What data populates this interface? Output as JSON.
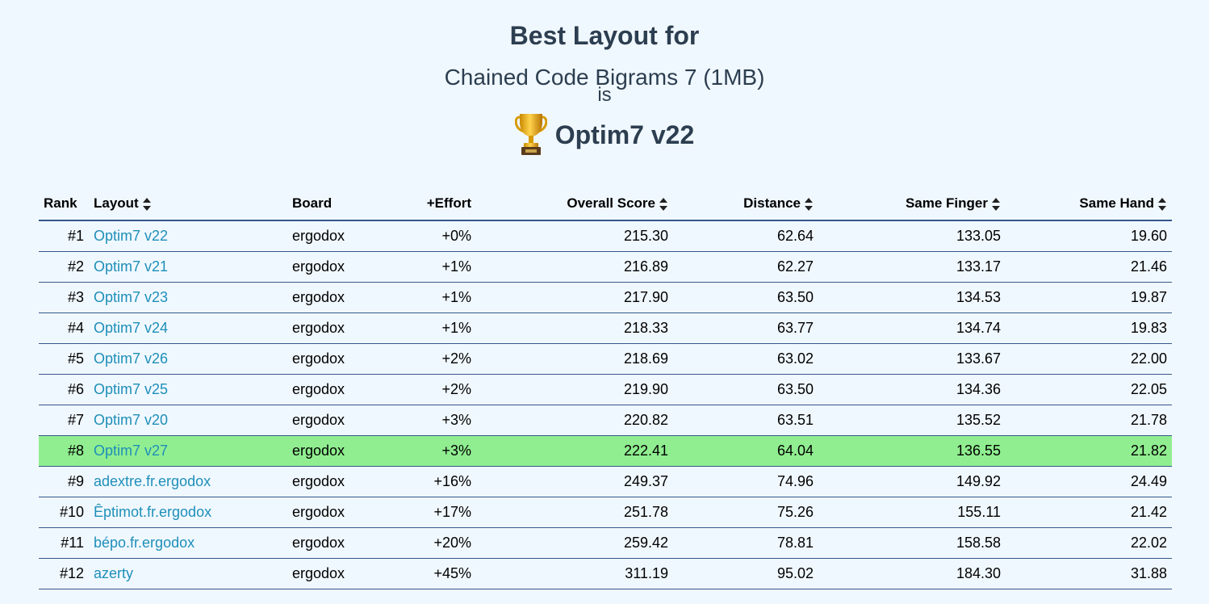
{
  "header": {
    "title": "Best Layout for",
    "subtitle": "Chained Code Bigrams 7 (1MB)",
    "is_text": "is",
    "winner": "Optim7 v22",
    "winner_icon": "trophy-icon"
  },
  "colors": {
    "background": "#f0f8ff",
    "heading": "#2c3e50",
    "link": "#1e8fb8",
    "highlight": "#90ee90",
    "border": "#34568b"
  },
  "table": {
    "columns": {
      "rank": "Rank",
      "layout": "Layout",
      "board": "Board",
      "effort": "+Effort",
      "overall": "Overall Score",
      "distance": "Distance",
      "same_finger": "Same Finger",
      "same_hand": "Same Hand"
    },
    "sort_icon": "sort-icon",
    "rows": [
      {
        "rank": "#1",
        "layout": "Optim7 v22",
        "board": "ergodox",
        "effort": "+0%",
        "overall": "215.30",
        "distance": "62.64",
        "same_finger": "133.05",
        "same_hand": "19.60"
      },
      {
        "rank": "#2",
        "layout": "Optim7 v21",
        "board": "ergodox",
        "effort": "+1%",
        "overall": "216.89",
        "distance": "62.27",
        "same_finger": "133.17",
        "same_hand": "21.46"
      },
      {
        "rank": "#3",
        "layout": "Optim7 v23",
        "board": "ergodox",
        "effort": "+1%",
        "overall": "217.90",
        "distance": "63.50",
        "same_finger": "134.53",
        "same_hand": "19.87"
      },
      {
        "rank": "#4",
        "layout": "Optim7 v24",
        "board": "ergodox",
        "effort": "+1%",
        "overall": "218.33",
        "distance": "63.77",
        "same_finger": "134.74",
        "same_hand": "19.83"
      },
      {
        "rank": "#5",
        "layout": "Optim7 v26",
        "board": "ergodox",
        "effort": "+2%",
        "overall": "218.69",
        "distance": "63.02",
        "same_finger": "133.67",
        "same_hand": "22.00"
      },
      {
        "rank": "#6",
        "layout": "Optim7 v25",
        "board": "ergodox",
        "effort": "+2%",
        "overall": "219.90",
        "distance": "63.50",
        "same_finger": "134.36",
        "same_hand": "22.05"
      },
      {
        "rank": "#7",
        "layout": "Optim7 v20",
        "board": "ergodox",
        "effort": "+3%",
        "overall": "220.82",
        "distance": "63.51",
        "same_finger": "135.52",
        "same_hand": "21.78"
      },
      {
        "rank": "#8",
        "layout": "Optim7 v27",
        "board": "ergodox",
        "effort": "+3%",
        "overall": "222.41",
        "distance": "64.04",
        "same_finger": "136.55",
        "same_hand": "21.82",
        "highlighted": true
      },
      {
        "rank": "#9",
        "layout": "adextre.fr.ergodox",
        "board": "ergodox",
        "effort": "+16%",
        "overall": "249.37",
        "distance": "74.96",
        "same_finger": "149.92",
        "same_hand": "24.49"
      },
      {
        "rank": "#10",
        "layout": "Êptimot.fr.ergodox",
        "board": "ergodox",
        "effort": "+17%",
        "overall": "251.78",
        "distance": "75.26",
        "same_finger": "155.11",
        "same_hand": "21.42"
      },
      {
        "rank": "#11",
        "layout": "bépo.fr.ergodox",
        "board": "ergodox",
        "effort": "+20%",
        "overall": "259.42",
        "distance": "78.81",
        "same_finger": "158.58",
        "same_hand": "22.02"
      },
      {
        "rank": "#12",
        "layout": "azerty",
        "board": "ergodox",
        "effort": "+45%",
        "overall": "311.19",
        "distance": "95.02",
        "same_finger": "184.30",
        "same_hand": "31.88"
      }
    ]
  }
}
